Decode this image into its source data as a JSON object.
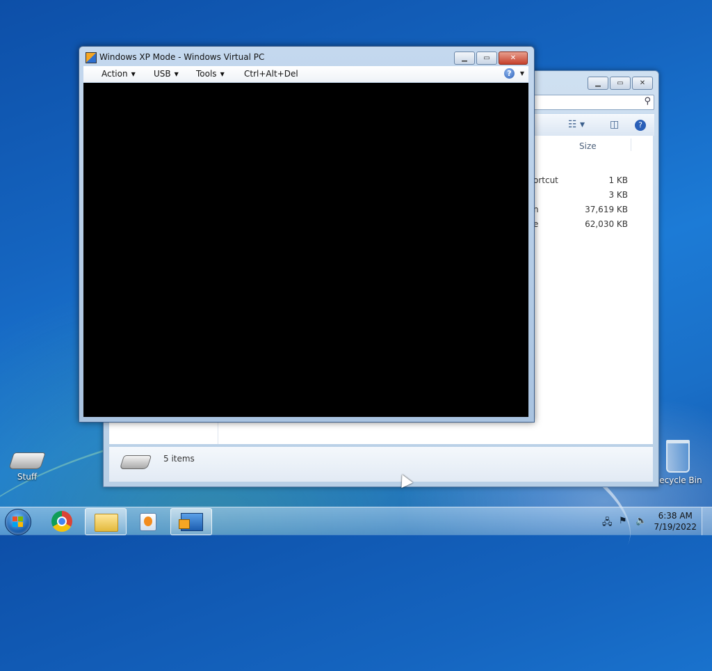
{
  "desktop": {
    "icons": [
      {
        "label": "Stuff"
      },
      {
        "label": "Recycle Bin"
      }
    ]
  },
  "explorer": {
    "column_size": "Size",
    "rows": [
      {
        "name_fragment": "ortcut",
        "size": "1 KB"
      },
      {
        "name_fragment": "",
        "size": "3 KB"
      },
      {
        "name_fragment": "n",
        "size": "37,619 KB"
      },
      {
        "name_fragment": "e",
        "size": "62,030 KB"
      }
    ],
    "status_text": "5 items"
  },
  "vpc_window": {
    "title": "Windows XP Mode - Windows Virtual PC",
    "menu": {
      "action": "Action",
      "usb": "USB",
      "tools": "Tools",
      "cad": "Ctrl+Alt+Del"
    },
    "help_glyph": "?"
  },
  "taskbar": {
    "time": "6:38 AM",
    "date": "7/19/2022"
  },
  "colors": {
    "desktop": "#1565c0",
    "close_red": "#c6402b",
    "screen": "#000000"
  }
}
